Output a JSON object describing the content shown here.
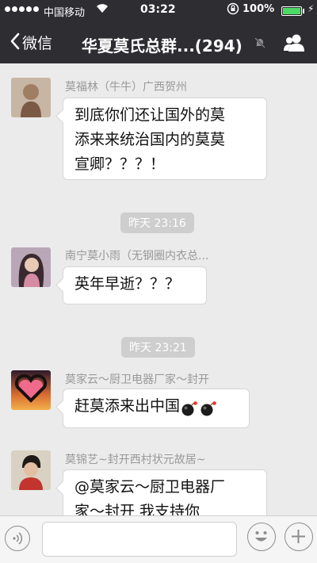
{
  "status_bar": {
    "carrier": "中国移动",
    "time": "03:22",
    "battery": "100%",
    "battery_level": 1.0
  },
  "nav": {
    "back_label": "微信",
    "title": "华夏莫氏总群...(294)"
  },
  "messages": [
    {
      "sender": "莫福林（牛牛）广西贺州",
      "text_lines": [
        "到底你们还让国外的莫",
        "添来来统治国内的莫莫",
        "宣卿？？？！"
      ]
    },
    {
      "sender": "南宁莫小雨（无钢圈内衣总...",
      "text_lines": [
        "英年早逝？？？"
      ]
    },
    {
      "sender": "莫家云～厨卫电器厂家～封开",
      "text_lines": [
        "赶莫添来出中国"
      ]
    },
    {
      "sender": "莫锦艺~封开西村状元故居~",
      "text_lines": [
        "@莫家云～厨卫电器厂",
        "家～封开 我支持你"
      ]
    }
  ],
  "time_labels": [
    "昨天 23:16",
    "昨天 23:21"
  ],
  "icons": {
    "back": "chevron-left-icon",
    "mute": "bell-slash-icon",
    "members": "people-icon",
    "voice": "voice-icon",
    "emoji": "smiley-icon",
    "plus": "plus-icon",
    "bomb": "bomb-emoji-icon"
  },
  "colors": {
    "header": "#2d2d32",
    "chat_background": "#ebebeb",
    "bubble": "#ffffff",
    "time_label": "#cecece"
  }
}
